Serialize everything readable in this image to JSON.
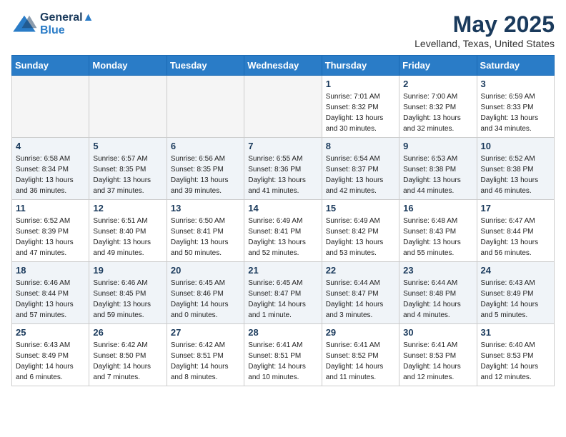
{
  "header": {
    "logo_line1": "General",
    "logo_line2": "Blue",
    "month_title": "May 2025",
    "location": "Levelland, Texas, United States"
  },
  "weekdays": [
    "Sunday",
    "Monday",
    "Tuesday",
    "Wednesday",
    "Thursday",
    "Friday",
    "Saturday"
  ],
  "weeks": [
    [
      {
        "day": "",
        "empty": true
      },
      {
        "day": "",
        "empty": true
      },
      {
        "day": "",
        "empty": true
      },
      {
        "day": "",
        "empty": true
      },
      {
        "day": "1",
        "sunrise": "7:01 AM",
        "sunset": "8:32 PM",
        "daylight": "13 hours and 30 minutes."
      },
      {
        "day": "2",
        "sunrise": "7:00 AM",
        "sunset": "8:32 PM",
        "daylight": "13 hours and 32 minutes."
      },
      {
        "day": "3",
        "sunrise": "6:59 AM",
        "sunset": "8:33 PM",
        "daylight": "13 hours and 34 minutes."
      }
    ],
    [
      {
        "day": "4",
        "sunrise": "6:58 AM",
        "sunset": "8:34 PM",
        "daylight": "13 hours and 36 minutes."
      },
      {
        "day": "5",
        "sunrise": "6:57 AM",
        "sunset": "8:35 PM",
        "daylight": "13 hours and 37 minutes."
      },
      {
        "day": "6",
        "sunrise": "6:56 AM",
        "sunset": "8:35 PM",
        "daylight": "13 hours and 39 minutes."
      },
      {
        "day": "7",
        "sunrise": "6:55 AM",
        "sunset": "8:36 PM",
        "daylight": "13 hours and 41 minutes."
      },
      {
        "day": "8",
        "sunrise": "6:54 AM",
        "sunset": "8:37 PM",
        "daylight": "13 hours and 42 minutes."
      },
      {
        "day": "9",
        "sunrise": "6:53 AM",
        "sunset": "8:38 PM",
        "daylight": "13 hours and 44 minutes."
      },
      {
        "day": "10",
        "sunrise": "6:52 AM",
        "sunset": "8:38 PM",
        "daylight": "13 hours and 46 minutes."
      }
    ],
    [
      {
        "day": "11",
        "sunrise": "6:52 AM",
        "sunset": "8:39 PM",
        "daylight": "13 hours and 47 minutes."
      },
      {
        "day": "12",
        "sunrise": "6:51 AM",
        "sunset": "8:40 PM",
        "daylight": "13 hours and 49 minutes."
      },
      {
        "day": "13",
        "sunrise": "6:50 AM",
        "sunset": "8:41 PM",
        "daylight": "13 hours and 50 minutes."
      },
      {
        "day": "14",
        "sunrise": "6:49 AM",
        "sunset": "8:41 PM",
        "daylight": "13 hours and 52 minutes."
      },
      {
        "day": "15",
        "sunrise": "6:49 AM",
        "sunset": "8:42 PM",
        "daylight": "13 hours and 53 minutes."
      },
      {
        "day": "16",
        "sunrise": "6:48 AM",
        "sunset": "8:43 PM",
        "daylight": "13 hours and 55 minutes."
      },
      {
        "day": "17",
        "sunrise": "6:47 AM",
        "sunset": "8:44 PM",
        "daylight": "13 hours and 56 minutes."
      }
    ],
    [
      {
        "day": "18",
        "sunrise": "6:46 AM",
        "sunset": "8:44 PM",
        "daylight": "13 hours and 57 minutes."
      },
      {
        "day": "19",
        "sunrise": "6:46 AM",
        "sunset": "8:45 PM",
        "daylight": "13 hours and 59 minutes."
      },
      {
        "day": "20",
        "sunrise": "6:45 AM",
        "sunset": "8:46 PM",
        "daylight": "14 hours and 0 minutes."
      },
      {
        "day": "21",
        "sunrise": "6:45 AM",
        "sunset": "8:47 PM",
        "daylight": "14 hours and 1 minute."
      },
      {
        "day": "22",
        "sunrise": "6:44 AM",
        "sunset": "8:47 PM",
        "daylight": "14 hours and 3 minutes."
      },
      {
        "day": "23",
        "sunrise": "6:44 AM",
        "sunset": "8:48 PM",
        "daylight": "14 hours and 4 minutes."
      },
      {
        "day": "24",
        "sunrise": "6:43 AM",
        "sunset": "8:49 PM",
        "daylight": "14 hours and 5 minutes."
      }
    ],
    [
      {
        "day": "25",
        "sunrise": "6:43 AM",
        "sunset": "8:49 PM",
        "daylight": "14 hours and 6 minutes."
      },
      {
        "day": "26",
        "sunrise": "6:42 AM",
        "sunset": "8:50 PM",
        "daylight": "14 hours and 7 minutes."
      },
      {
        "day": "27",
        "sunrise": "6:42 AM",
        "sunset": "8:51 PM",
        "daylight": "14 hours and 8 minutes."
      },
      {
        "day": "28",
        "sunrise": "6:41 AM",
        "sunset": "8:51 PM",
        "daylight": "14 hours and 10 minutes."
      },
      {
        "day": "29",
        "sunrise": "6:41 AM",
        "sunset": "8:52 PM",
        "daylight": "14 hours and 11 minutes."
      },
      {
        "day": "30",
        "sunrise": "6:41 AM",
        "sunset": "8:53 PM",
        "daylight": "14 hours and 12 minutes."
      },
      {
        "day": "31",
        "sunrise": "6:40 AM",
        "sunset": "8:53 PM",
        "daylight": "14 hours and 12 minutes."
      }
    ]
  ]
}
